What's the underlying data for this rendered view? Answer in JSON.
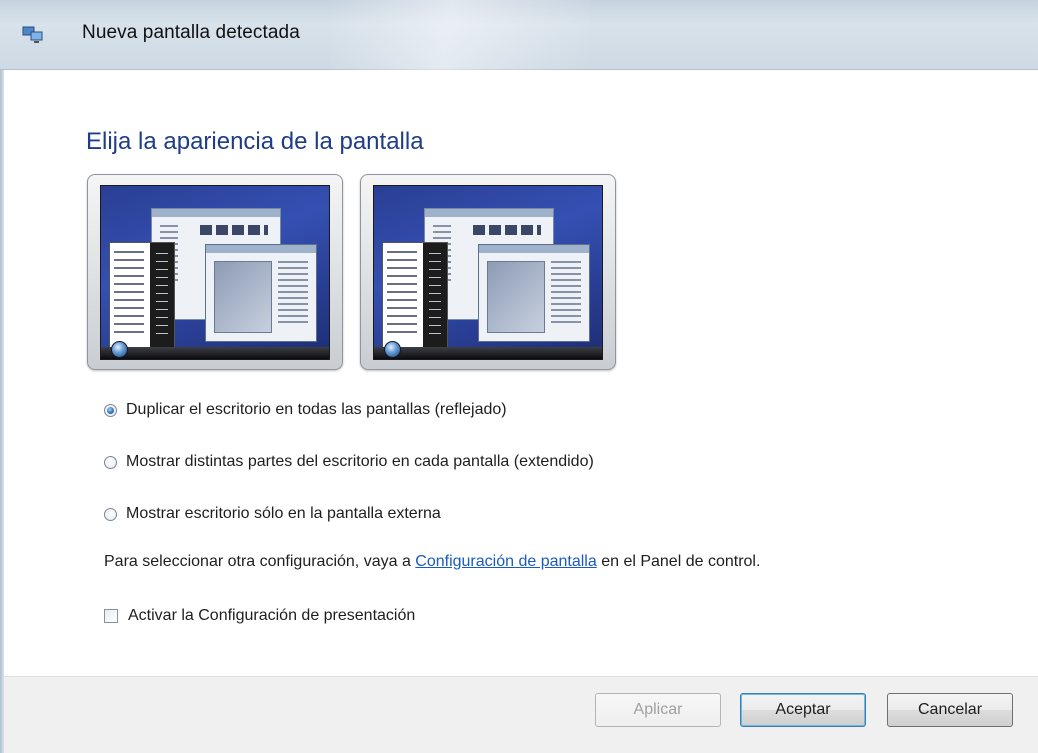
{
  "window": {
    "title": "Nueva pantalla detectada",
    "icon": "display-settings-icon"
  },
  "main": {
    "heading": "Elija la apariencia de la pantalla",
    "previews": [
      {
        "name": "mirrored-preview",
        "icon": "desktop-preview-icon"
      },
      {
        "name": "extended-preview",
        "icon": "desktop-preview-icon"
      }
    ],
    "options": [
      {
        "label": "Duplicar el escritorio en todas las pantallas (reflejado)",
        "checked": true
      },
      {
        "label": "Mostrar distintas partes del escritorio en cada pantalla (extendido)",
        "checked": false
      },
      {
        "label": "Mostrar escritorio sólo en la pantalla externa",
        "checked": false
      }
    ],
    "info_prefix": "Para seleccionar otra configuración, vaya a ",
    "info_link": "Configuración de pantalla",
    "info_suffix": " en el Panel de control.",
    "checkbox_label": "Activar la Configuración de presentación",
    "checkbox_checked": false
  },
  "footer": {
    "apply_label": "Aplicar",
    "ok_label": "Aceptar",
    "cancel_label": "Cancelar"
  },
  "colors": {
    "heading": "#1f3c88",
    "link": "#1a5bbd"
  }
}
